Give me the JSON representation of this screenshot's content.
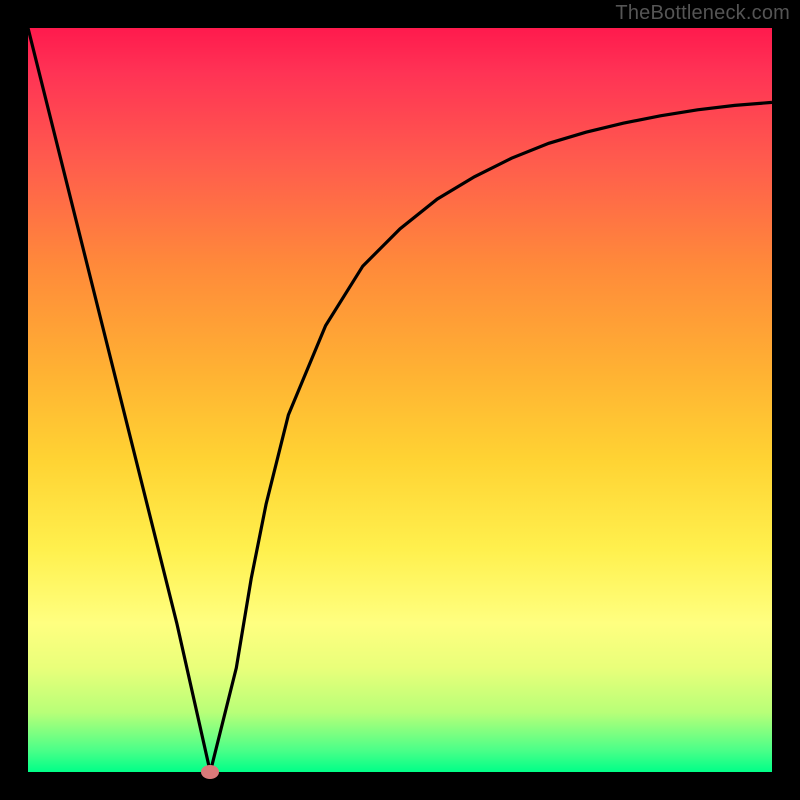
{
  "attribution": "TheBottleneck.com",
  "chart_data": {
    "type": "line",
    "title": "",
    "xlabel": "",
    "ylabel": "",
    "xlim": [
      0,
      100
    ],
    "ylim": [
      0,
      100
    ],
    "x": [
      0,
      5,
      10,
      15,
      20,
      24.5,
      28,
      30,
      32,
      35,
      40,
      45,
      50,
      55,
      60,
      65,
      70,
      75,
      80,
      85,
      90,
      95,
      100
    ],
    "values": [
      100,
      80,
      60,
      40,
      20,
      0,
      14,
      26,
      36,
      48,
      60,
      68,
      73,
      77,
      80,
      82.5,
      84.5,
      86,
      87.2,
      88.2,
      89,
      89.6,
      90
    ],
    "minimum_point": {
      "x": 24.5,
      "y": 0
    },
    "gradient_stops": [
      {
        "pos": 0,
        "color": "#ff1a4d"
      },
      {
        "pos": 50,
        "color": "#ffc040"
      },
      {
        "pos": 80,
        "color": "#ffff80"
      },
      {
        "pos": 100,
        "color": "#00ff88"
      }
    ]
  }
}
